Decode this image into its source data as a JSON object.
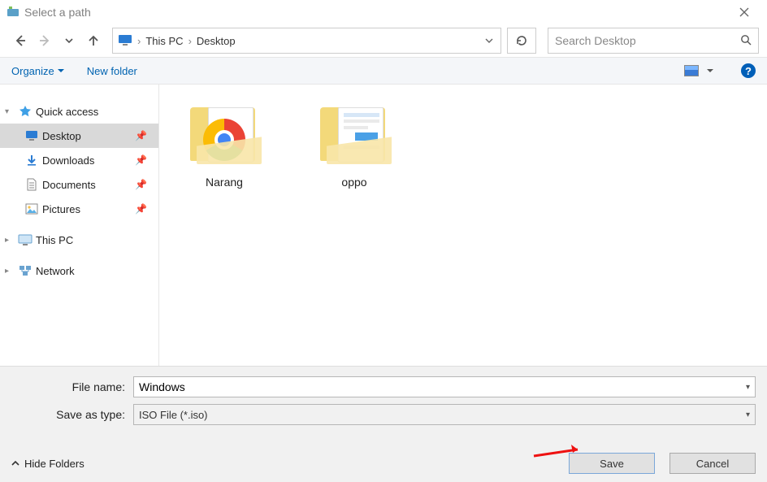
{
  "window": {
    "title": "Select a path"
  },
  "nav": {
    "breadcrumb": {
      "root": "This PC",
      "current": "Desktop"
    },
    "search_placeholder": "Search Desktop"
  },
  "toolbar": {
    "organize": "Organize",
    "new_folder": "New folder",
    "help_glyph": "?"
  },
  "sidebar": {
    "quick_access": "Quick access",
    "items": [
      {
        "label": "Desktop",
        "icon": "monitor",
        "pinned": true,
        "selected": true
      },
      {
        "label": "Downloads",
        "icon": "download",
        "pinned": true,
        "selected": false
      },
      {
        "label": "Documents",
        "icon": "document",
        "pinned": true,
        "selected": false
      },
      {
        "label": "Pictures",
        "icon": "pictures",
        "pinned": true,
        "selected": false
      }
    ],
    "this_pc": "This PC",
    "network": "Network"
  },
  "content": {
    "folders": [
      {
        "label": "Narang",
        "kind": "chrome"
      },
      {
        "label": "oppo",
        "kind": "files"
      }
    ]
  },
  "form": {
    "file_name_label": "File name:",
    "file_name_value": "Windows",
    "save_type_label": "Save as type:",
    "save_type_value": "ISO File (*.iso)"
  },
  "actions": {
    "hide_folders": "Hide Folders",
    "save": "Save",
    "cancel": "Cancel"
  }
}
